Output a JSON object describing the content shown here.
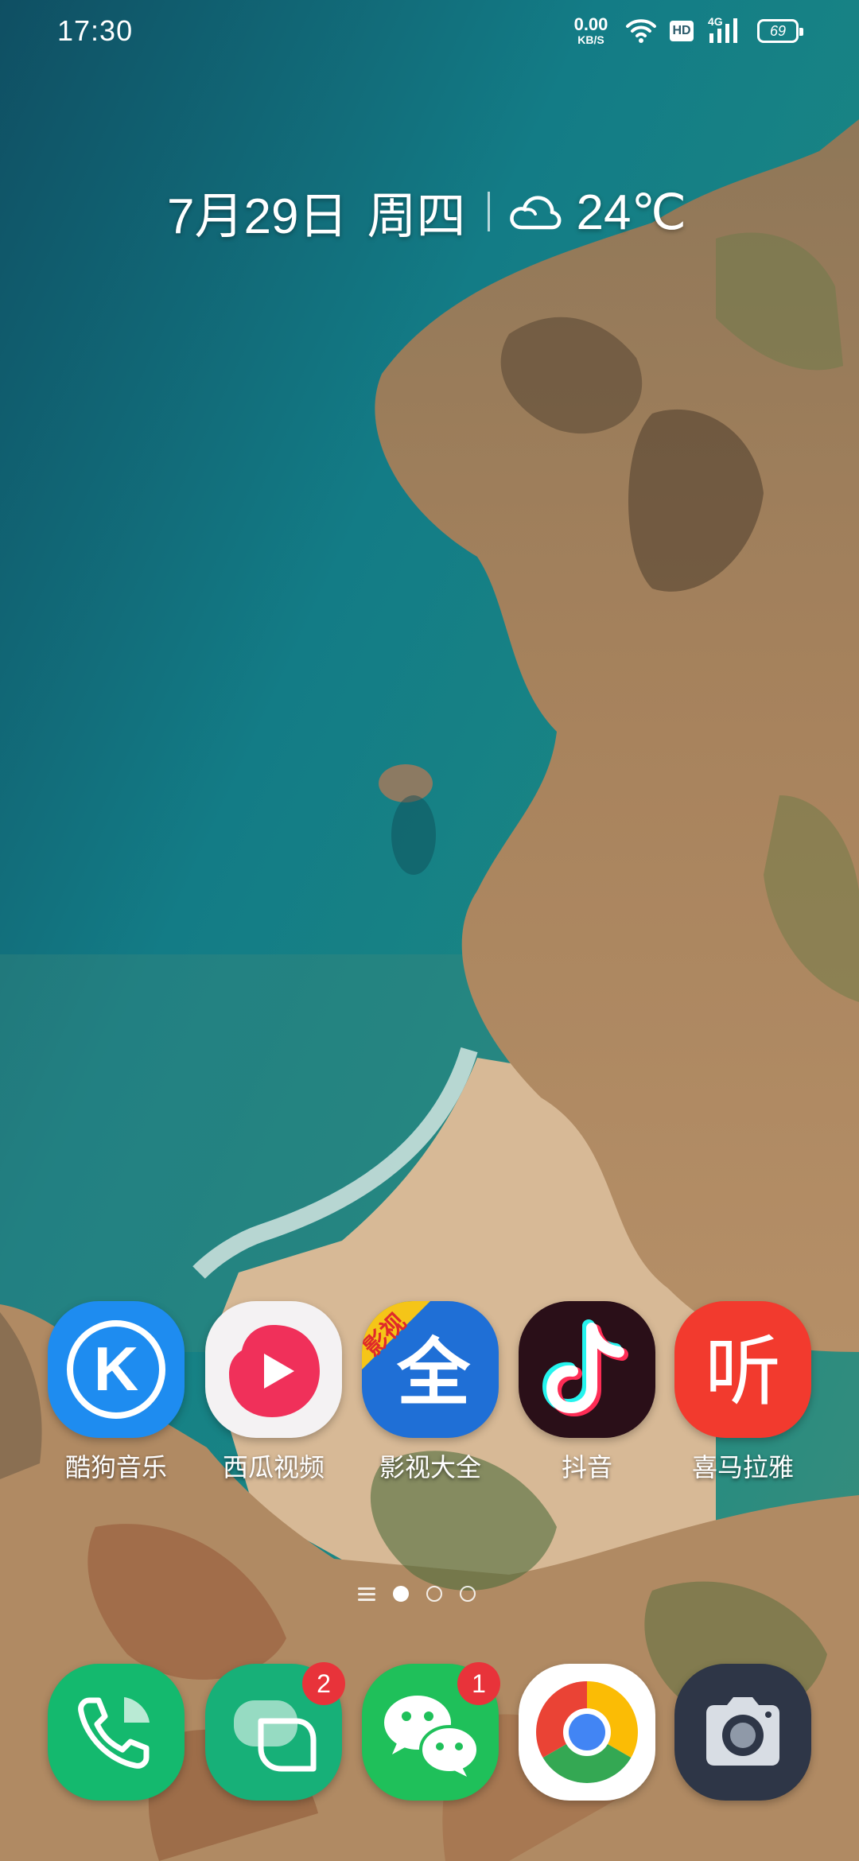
{
  "status_bar": {
    "time": "17:30",
    "net_speed_value": "0.00",
    "net_speed_unit": "KB/S",
    "hd_label": "HD",
    "network_type": "4G",
    "battery_level": "69",
    "icons": [
      "wifi-icon",
      "hd-icon",
      "signal-icon",
      "battery-icon"
    ]
  },
  "widget": {
    "date": "7月29日",
    "weekday": "周四",
    "temperature": "24℃",
    "weather_icon": "cloudy-icon"
  },
  "apps": [
    {
      "label": "酷狗音乐",
      "icon": "kugou-music-icon",
      "color": "#1e8cf0"
    },
    {
      "label": "西瓜视频",
      "icon": "xigua-video-icon",
      "color": "#f0305a"
    },
    {
      "label": "影视大全",
      "icon": "yingshi-daquan-icon",
      "color": "#1f6fd6",
      "corner_text": "影视",
      "glyph": "全"
    },
    {
      "label": "抖音",
      "icon": "douyin-icon",
      "color": "#2a0f18"
    },
    {
      "label": "喜马拉雅",
      "icon": "ximalaya-icon",
      "color": "#f23a2e",
      "glyph": "听"
    }
  ],
  "page_indicator": {
    "pages": 3,
    "current": 1
  },
  "dock": [
    {
      "name": "phone",
      "icon": "phone-icon",
      "color": "#14b96e"
    },
    {
      "name": "messages",
      "icon": "messages-icon",
      "color": "#17b078",
      "badge": "2"
    },
    {
      "name": "wechat",
      "icon": "wechat-icon",
      "color": "#1fc05a",
      "badge": "1"
    },
    {
      "name": "chrome",
      "icon": "chrome-icon",
      "color": "#ffffff"
    },
    {
      "name": "camera",
      "icon": "camera-icon",
      "color": "#2e3647"
    }
  ]
}
